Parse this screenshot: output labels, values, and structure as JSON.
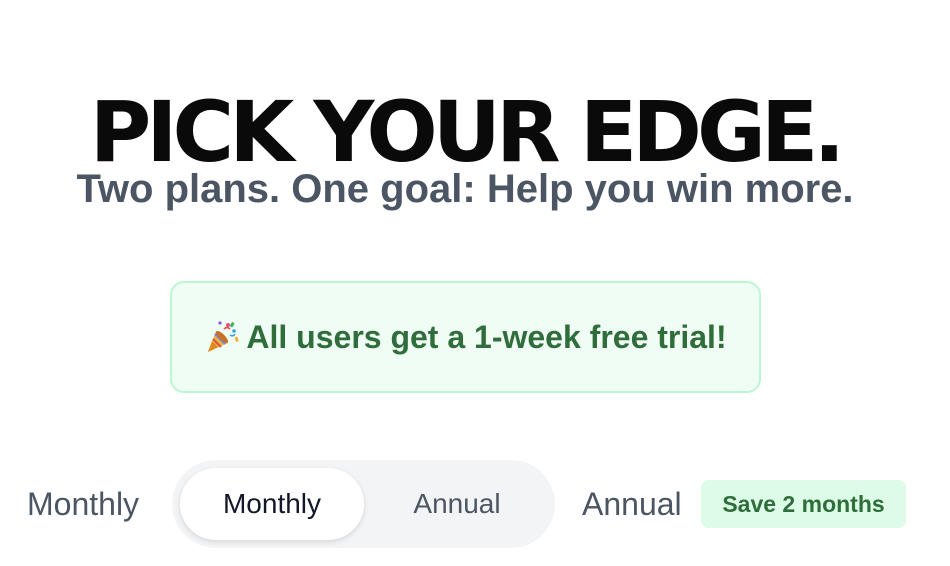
{
  "hero": {
    "headline": "PICK YOUR EDGE.",
    "subtitle": "Two plans. One goal: Help you win more."
  },
  "trial_banner": {
    "icon": "party-popper-icon",
    "text": "All users get a 1-week free trial!"
  },
  "billing_toggle": {
    "outer_monthly_label": "Monthly",
    "outer_annual_label": "Annual",
    "options": [
      "Monthly",
      "Annual"
    ],
    "selected": "Monthly",
    "save_badge": "Save 2 months"
  },
  "colors": {
    "headline": "#0a0a0a",
    "subtitle": "#4b5563",
    "banner_bg": "#f0fdf4",
    "banner_border": "#bbf7d0",
    "banner_text": "#2f6d3a",
    "toggle_track": "#f3f4f6",
    "badge_bg": "#dcfce7"
  }
}
